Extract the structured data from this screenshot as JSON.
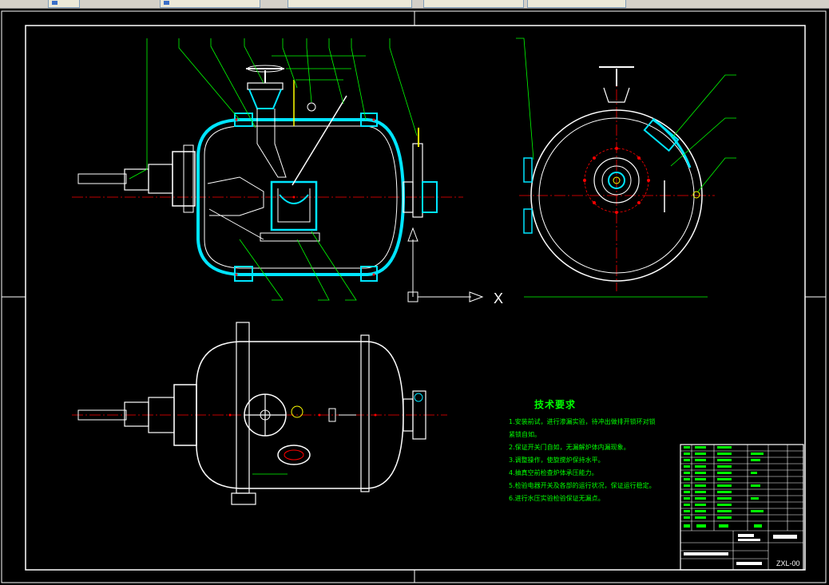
{
  "window": {
    "tabs": [
      {
        "label": ""
      },
      {
        "label": ""
      },
      {
        "label": ""
      },
      {
        "label": ""
      },
      {
        "label": ""
      }
    ]
  },
  "drawing": {
    "axis_label": "X",
    "tech_requirements": {
      "title": "技术要求",
      "items": [
        "1.安装前试，进行渗漏实验，待冲出做排开锁环对锁",
        "  紧锁自如。",
        "2.保证开关门自如，无漏解炉体内漏现象。",
        "3.调整操作，使旋搅炉保持水平。",
        "4.抽真空前检查炉体承压能力。",
        "5.检验电器开关及各部的运行状况，保证运行稳定。",
        "6.进行水压实验检验保证无漏点。"
      ]
    },
    "title_block": {
      "drawing_number": "ZXL-00"
    },
    "colors": {
      "background": "#000000",
      "outline": "#ffffff",
      "vessel": "#00e5ff",
      "centerline": "#ff0000",
      "leader": "#00ff00",
      "part": "#ff00ff",
      "accent": "#ffff00"
    }
  }
}
